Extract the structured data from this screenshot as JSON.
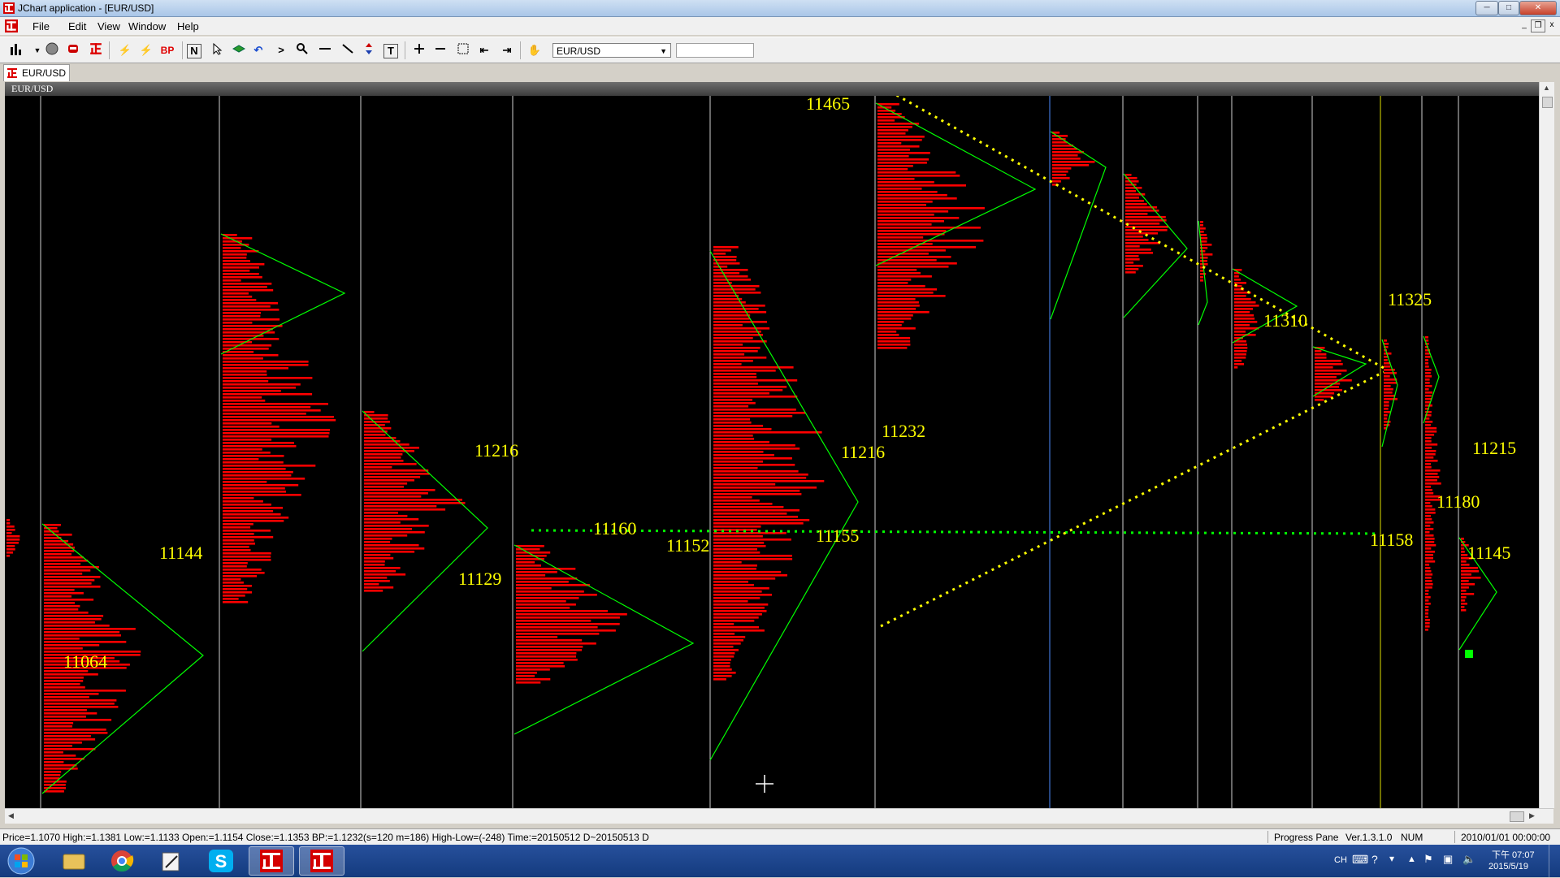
{
  "window": {
    "title": "JChart application - [EUR/USD]",
    "min": "─",
    "max": "□",
    "close": "✕"
  },
  "menu": {
    "items": [
      "File",
      "Edit",
      "View",
      "Window",
      "Help"
    ],
    "mdi_min": "_",
    "mdi_restore": "❐",
    "mdi_close": "x"
  },
  "toolbar": {
    "bp_label": "BP",
    "n_label": "N",
    "t_label": "T",
    "symbol_value": "EUR/USD",
    "symbol_text": ""
  },
  "tab": {
    "label": "EUR/USD"
  },
  "chart": {
    "header": "EUR/USD",
    "accent_red": "#ff0000",
    "accent_yellow": "#ffff00",
    "accent_green": "#00ff00",
    "annotations": [
      "11465",
      "11325",
      "11310",
      "11232",
      "11216",
      "11216",
      "11155",
      "11160",
      "11152",
      "11129",
      "11144",
      "11064",
      "11215",
      "11180",
      "11158",
      "11145"
    ]
  },
  "status": {
    "info": "Price=1.1070  High:=1.1381  Low:=1.1133  Open:=1.1154  Close:=1.1353  BP:=1.1232(s=120 m=186)  High-Low=(-248)  Time:=20150512 D~20150513 D",
    "pane": "Progress Pane",
    "version": "Ver.1.3.1.0",
    "num": "NUM",
    "datetime": "2010/01/01 00:00:00"
  },
  "taskbar": {
    "lang": "CH",
    "time": "下午 07:07",
    "date": "2015/5/19"
  }
}
